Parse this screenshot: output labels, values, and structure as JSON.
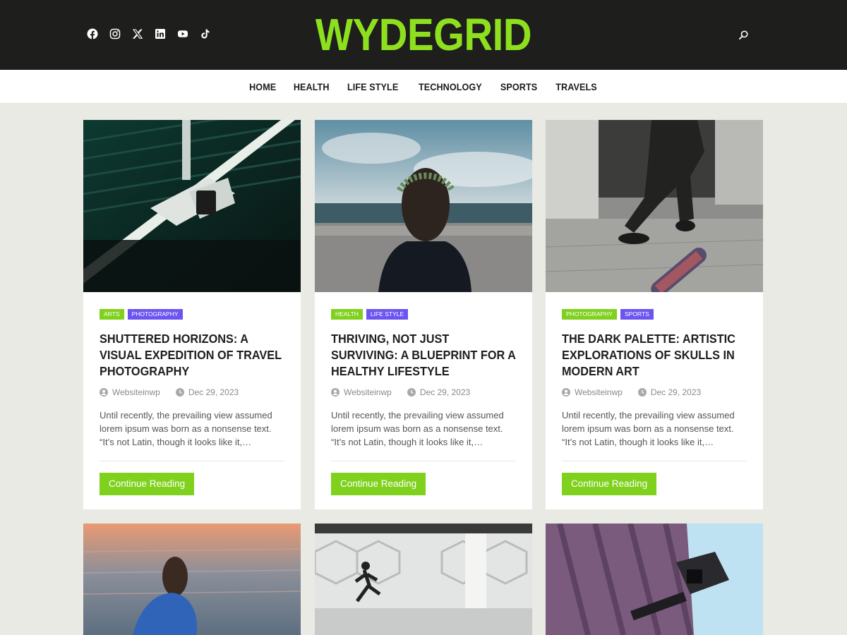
{
  "site": {
    "logo": "WYDEGRID"
  },
  "social_icons": [
    "facebook-icon",
    "instagram-icon",
    "x-twitter-icon",
    "linkedin-icon",
    "youtube-icon",
    "tiktok-icon"
  ],
  "nav": [
    "HOME",
    "HEALTH",
    "LIFE STYLE",
    "TECHNOLOGY",
    "SPORTS",
    "TRAVELS"
  ],
  "colors": {
    "accent": "#8ee01f",
    "category_green": "#7fd11d",
    "category_purple": "#6b55f1",
    "header_bg": "#1e1e1c",
    "page_bg": "#e9eae3"
  },
  "posts": [
    {
      "image": "security-camera-photo",
      "categories": [
        "ARTS",
        "PHOTOGRAPHY"
      ],
      "title": "SHUTTERED HORIZONS: A VISUAL EXPEDITION OF TRAVEL PHOTOGRAPHY",
      "author": "Websiteinwp",
      "date": "Dec 29, 2023",
      "excerpt": "Until recently, the prevailing view assumed lorem ipsum was born as a nonsense text. “It’s not Latin, though it looks like it,…",
      "button": "Continue Reading"
    },
    {
      "image": "woman-on-beach-photo",
      "categories": [
        "HEALTH",
        "LIFE STYLE"
      ],
      "title": "THRIVING, NOT JUST SURVIVING: A BLUEPRINT FOR A HEALTHY LIFESTYLE",
      "author": "Websiteinwp",
      "date": "Dec 29, 2023",
      "excerpt": "Until recently, the prevailing view assumed lorem ipsum was born as a nonsense text. “It’s not Latin, though it looks like it,…",
      "button": "Continue Reading"
    },
    {
      "image": "skateboarder-photo",
      "categories": [
        "PHOTOGRAPHY",
        "SPORTS"
      ],
      "title": "THE DARK PALETTE: ARTISTIC EXPLORATIONS OF SKULLS IN MODERN ART",
      "author": "Websiteinwp",
      "date": "Dec 29, 2023",
      "excerpt": "Until recently, the prevailing view assumed lorem ipsum was born as a nonsense text. “It’s not Latin, though it looks like it,…",
      "button": "Continue Reading"
    },
    {
      "image": "woman-in-sea-photo"
    },
    {
      "image": "running-man-architecture-photo"
    },
    {
      "image": "cctv-camera-photo"
    }
  ]
}
